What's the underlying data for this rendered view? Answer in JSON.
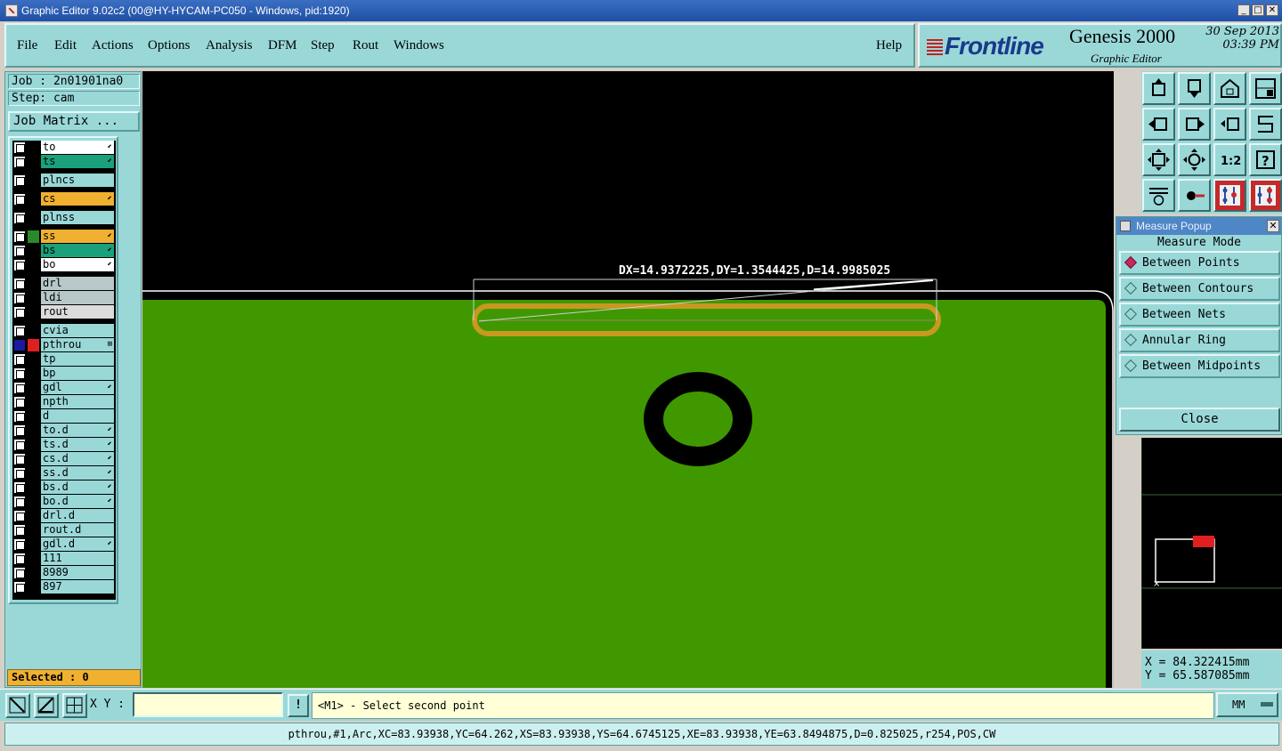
{
  "window": {
    "title": "Graphic Editor 9.02c2 (00@HY-HYCAM-PC050 - Windows, pid:1920)",
    "controls": [
      "_",
      "□",
      "✕"
    ]
  },
  "menu": {
    "file": "File",
    "edit": "Edit",
    "actions": "Actions",
    "options": "Options",
    "analysis": "Analysis",
    "dfm": "DFM",
    "step": "Step",
    "rout": "Rout",
    "windows": "Windows",
    "help": "Help"
  },
  "branding": {
    "logo": "Frontline",
    "product": "Genesis 2000",
    "subtitle": "Graphic Editor",
    "date": "30 Sep 2013",
    "time": "03:39 PM"
  },
  "job": {
    "job_line": "Job : 2n01901na0",
    "step_line": "Step: cam",
    "matrix_button": "Job Matrix ..."
  },
  "layers": [
    {
      "name": "to",
      "color": "#ffffff",
      "swatch": "#000000",
      "checked": false,
      "mark": "⬋"
    },
    {
      "name": "ts",
      "color": "#1aa07a",
      "swatch": "#000000",
      "checked": false,
      "mark": "⬋"
    },
    {
      "name": "plncs",
      "color": "#9ad8d8",
      "swatch": "#000000",
      "checked": false,
      "mark": ""
    },
    {
      "name": "cs",
      "color": "#f0b030",
      "swatch": "#000000",
      "checked": false,
      "mark": "⬋"
    },
    {
      "name": "plnss",
      "color": "#9ad8d8",
      "swatch": "#000000",
      "checked": false,
      "mark": ""
    },
    {
      "name": "ss",
      "color": "#f0b030",
      "swatch": "#2a8a2a",
      "checked": false,
      "mark": "⬋"
    },
    {
      "name": "bs",
      "color": "#1aa07a",
      "swatch": "#000000",
      "checked": false,
      "mark": "⬋"
    },
    {
      "name": "bo",
      "color": "#ffffff",
      "swatch": "#000000",
      "checked": false,
      "mark": "⬋"
    },
    {
      "name": "drl",
      "color": "#b8c8c8",
      "swatch": "#000000",
      "checked": false,
      "mark": ""
    },
    {
      "name": "ldi",
      "color": "#b8c8c8",
      "swatch": "#000000",
      "checked": false,
      "mark": ""
    },
    {
      "name": "rout",
      "color": "#dcdcdc",
      "swatch": "#000000",
      "checked": false,
      "mark": ""
    },
    {
      "name": "cvia",
      "color": "#9ad8d8",
      "swatch": "#000000",
      "checked": false,
      "mark": ""
    },
    {
      "name": "pthrou",
      "color": "#9ad8d8",
      "swatch": "#e02020",
      "checked": true,
      "mark": "⊞"
    },
    {
      "name": "tp",
      "color": "#9ad8d8",
      "swatch": "#000000",
      "checked": false,
      "mark": ""
    },
    {
      "name": "bp",
      "color": "#9ad8d8",
      "swatch": "#000000",
      "checked": false,
      "mark": ""
    },
    {
      "name": "gdl",
      "color": "#9ad8d8",
      "swatch": "#000000",
      "checked": false,
      "mark": "⬋"
    },
    {
      "name": "npth",
      "color": "#9ad8d8",
      "swatch": "#000000",
      "checked": false,
      "mark": ""
    },
    {
      "name": "d",
      "color": "#9ad8d8",
      "swatch": "#000000",
      "checked": false,
      "mark": ""
    },
    {
      "name": "to.d",
      "color": "#9ad8d8",
      "swatch": "#000000",
      "checked": false,
      "mark": "⬋"
    },
    {
      "name": "ts.d",
      "color": "#9ad8d8",
      "swatch": "#000000",
      "checked": false,
      "mark": "⬋"
    },
    {
      "name": "cs.d",
      "color": "#9ad8d8",
      "swatch": "#000000",
      "checked": false,
      "mark": "⬋"
    },
    {
      "name": "ss.d",
      "color": "#9ad8d8",
      "swatch": "#000000",
      "checked": false,
      "mark": "⬋"
    },
    {
      "name": "bs.d",
      "color": "#9ad8d8",
      "swatch": "#000000",
      "checked": false,
      "mark": "⬋"
    },
    {
      "name": "bo.d",
      "color": "#9ad8d8",
      "swatch": "#000000",
      "checked": false,
      "mark": "⬋"
    },
    {
      "name": "drl.d",
      "color": "#9ad8d8",
      "swatch": "#000000",
      "checked": false,
      "mark": ""
    },
    {
      "name": "rout.d",
      "color": "#9ad8d8",
      "swatch": "#000000",
      "checked": false,
      "mark": ""
    },
    {
      "name": "gdl.d",
      "color": "#9ad8d8",
      "swatch": "#000000",
      "checked": false,
      "mark": "⬋"
    },
    {
      "name": "111",
      "color": "#9ad8d8",
      "swatch": "#000000",
      "checked": false,
      "mark": ""
    },
    {
      "name": "8989",
      "color": "#9ad8d8",
      "swatch": "#000000",
      "checked": false,
      "mark": ""
    },
    {
      "name": "897",
      "color": "#9ad8d8",
      "swatch": "#000000",
      "checked": false,
      "mark": ""
    }
  ],
  "selected": "Selected : 0",
  "canvas": {
    "measure_text": "DX=14.9372225,DY=1.3544425,D=14.9985025",
    "board_color": "#3f9800",
    "pad_color": "#c89820"
  },
  "toolbar_icons": [
    "zoom-home-icon",
    "page-down-icon",
    "home-view-icon",
    "split-window-icon",
    "pan-left-icon",
    "pan-right-icon",
    "undo-view-icon",
    "snap-icon",
    "fit-all-icon",
    "zoom-center-icon",
    "ratio-icon",
    "help-icon",
    "tools-icon",
    "measure-probe-icon",
    "net-red-icon",
    "net-compare-icon"
  ],
  "toolbar_labels": {
    "ratio": "1:2",
    "help": "?"
  },
  "measure_popup": {
    "title": "Measure Popup",
    "heading": "Measure Mode",
    "modes": [
      "Between Points",
      "Between Contours",
      "Between Nets",
      "Annular Ring",
      "Between Midpoints"
    ],
    "active_mode": "Between Points",
    "close": "Close"
  },
  "coords": {
    "x": "X = 84.322415mm",
    "y": "Y = 65.587085mm"
  },
  "command": {
    "xy_label": "X Y :",
    "xy_value": "",
    "bang": "!",
    "prompt": "<M1> - Select second point",
    "units": "MM"
  },
  "status": "pthrou,#1,Arc,XC=83.93938,YC=64.262,XS=83.93938,YS=64.6745125,XE=83.93938,YE=63.8494875,D=0.825025,r254,POS,CW"
}
